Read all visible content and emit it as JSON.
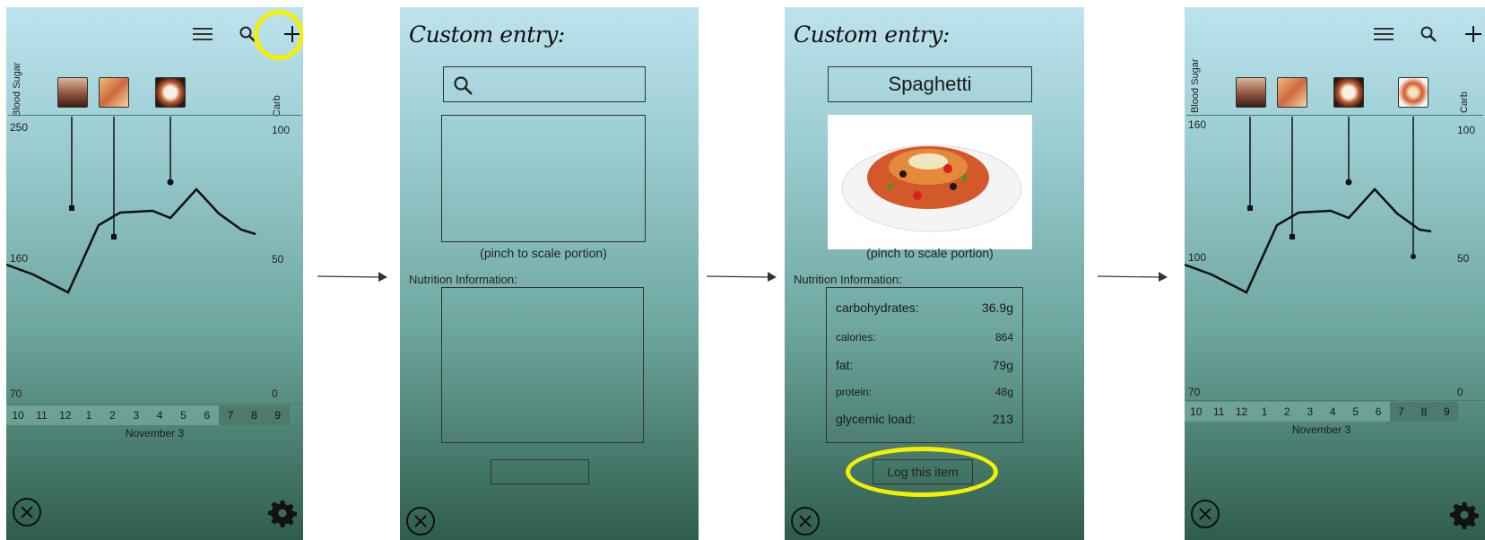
{
  "screen1": {
    "left_axis_label": "Blood Sugar",
    "right_axis_label": "Carb",
    "left_ticks": [
      "250",
      "160",
      "70"
    ],
    "right_ticks": [
      "100",
      "50",
      "0"
    ],
    "hours": [
      "10",
      "11",
      "12",
      "1",
      "2",
      "3",
      "4",
      "5",
      "6",
      "7",
      "8",
      "9"
    ],
    "highlighted_hours": [
      "7",
      "8",
      "9"
    ],
    "date": "November 3"
  },
  "screen2": {
    "title": "Custom entry:",
    "caption": "(pinch to scale portion)",
    "nutrition_label": "Nutrition Information:"
  },
  "screen3": {
    "title": "Custom entry:",
    "food_name": "Spaghetti",
    "caption": "(pinch to scale portion)",
    "nutrition_label": "Nutrition Information:",
    "nutrition": [
      {
        "name": "carbohydrates:",
        "value": "36.9g"
      },
      {
        "name": "calories:",
        "value": "864"
      },
      {
        "name": "fat:",
        "value": "79g"
      },
      {
        "name": "protein:",
        "value": "48g"
      },
      {
        "name": "glycemic load:",
        "value": "213"
      }
    ],
    "log_button": "Log this item"
  },
  "screen4": {
    "left_axis_label": "Blood Sugar",
    "right_axis_label": "Carb",
    "left_ticks": [
      "160",
      "100",
      "70"
    ],
    "right_ticks": [
      "100",
      "50",
      "0"
    ],
    "hours": [
      "10",
      "11",
      "12",
      "1",
      "2",
      "3",
      "4",
      "5",
      "6",
      "7",
      "8",
      "9"
    ],
    "highlighted_hours": [
      "7",
      "8",
      "9"
    ],
    "date": "November 3"
  },
  "colors": {
    "highlight": "#f5f000",
    "gradient_top": "#bde3ee",
    "gradient_bottom": "#2f5d4c"
  }
}
